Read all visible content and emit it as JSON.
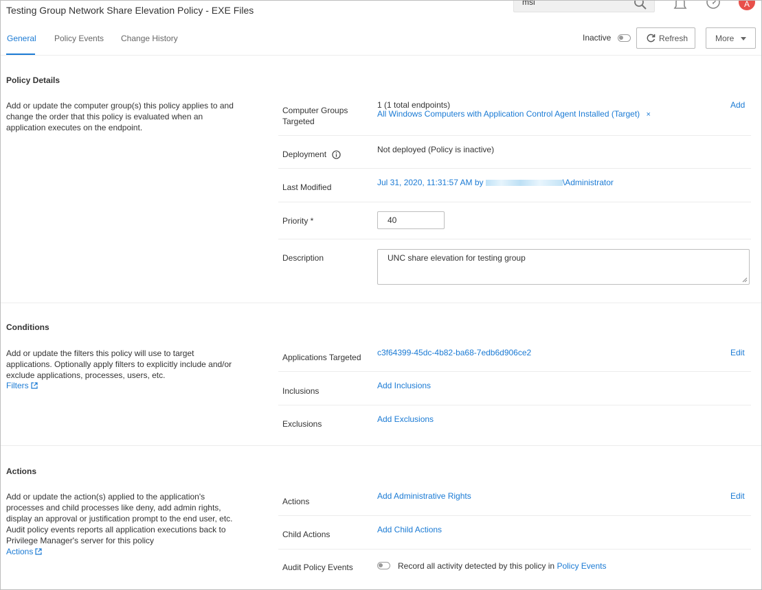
{
  "header": {
    "title": "Testing Group Network Share Elevation Policy - EXE Files",
    "search_value": "msi",
    "avatar_initial": "A"
  },
  "tabs": [
    "General",
    "Policy Events",
    "Change History"
  ],
  "toolbar": {
    "status_label": "Inactive",
    "refresh_label": "Refresh",
    "more_label": "More"
  },
  "policy_details": {
    "title": "Policy Details",
    "description": "Add or update the computer group(s) this policy applies to and change the order that this policy is evaluated when an application executes on the endpoint.",
    "computer_groups_label": "Computer Groups Targeted",
    "computer_groups_count": "1 (1 total endpoints)",
    "computer_groups_value": "All Windows Computers with Application Control Agent Installed (Target)",
    "add_label": "Add",
    "deployment_label": "Deployment",
    "deployment_value": "Not deployed (Policy is inactive)",
    "last_modified_label": "Last Modified",
    "last_modified_date": "Jul 31, 2020, 11:31:57 AM by",
    "last_modified_user": "\\Administrator",
    "priority_label": "Priority *",
    "priority_value": "40",
    "description_label": "Description",
    "description_value": "UNC share elevation for testing group"
  },
  "conditions": {
    "title": "Conditions",
    "description": "Add or update the filters this policy will use to target applications. Optionally apply filters to explicitly include and/or exclude applications, processes, users, etc.",
    "link": "Filters",
    "apps_targeted_label": "Applications Targeted",
    "apps_targeted_value": "c3f64399-45dc-4b82-ba68-7edb6d906ce2",
    "edit_label": "Edit",
    "inclusions_label": "Inclusions",
    "inclusions_value": "Add Inclusions",
    "exclusions_label": "Exclusions",
    "exclusions_value": "Add Exclusions"
  },
  "actions": {
    "title": "Actions",
    "description": "Add or update the action(s) applied to the application's processes and child processes like deny, add admin rights, display an approval or justification prompt to the end user, etc. Audit policy events reports all application executions back to Privilege Manager's server for this policy",
    "link": "Actions",
    "actions_label": "Actions",
    "actions_value": "Add Administrative Rights",
    "edit_label": "Edit",
    "child_actions_label": "Child Actions",
    "child_actions_value": "Add Child Actions",
    "audit_label": "Audit Policy Events",
    "audit_text": "Record all activity detected by this policy in",
    "audit_link": "Policy Events"
  },
  "colors": {
    "accent": "#1a7ad4",
    "avatar": "#e8504a"
  },
  "icons": [
    "search-icon",
    "bell-icon",
    "help-icon",
    "refresh-icon",
    "chevron-down-icon",
    "info-icon",
    "external-link-icon",
    "close-icon",
    "resize-handle-icon"
  ]
}
